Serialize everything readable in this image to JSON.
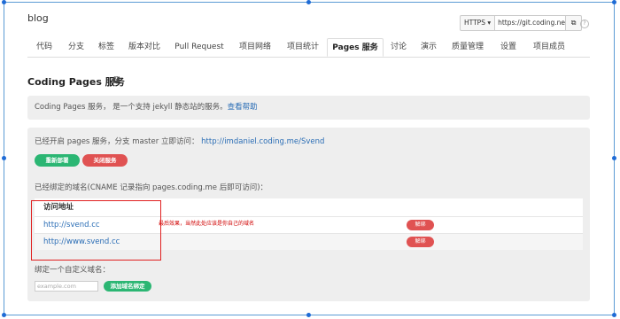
{
  "repo": {
    "name": "blog"
  },
  "clone": {
    "protocol": "HTTPS ▾",
    "url": "https://git.coding.net/",
    "copy_icon": "copy-icon"
  },
  "tabs": [
    {
      "label": "代码"
    },
    {
      "label": "分支"
    },
    {
      "label": "标签"
    },
    {
      "label": "版本对比"
    },
    {
      "label": "Pull Request"
    },
    {
      "label": "项目网络"
    },
    {
      "label": "项目统计"
    },
    {
      "label": "Pages 服务",
      "active": true
    },
    {
      "label": "讨论"
    },
    {
      "label": "演示"
    },
    {
      "label": "质量管理"
    },
    {
      "label": "设置"
    },
    {
      "label": "项目成员"
    }
  ],
  "page": {
    "title": "Coding Pages 服务",
    "info_text": "Coding Pages 服务， 是一个支持 jekyll 静态站的服务。",
    "info_link": "查看帮助"
  },
  "pages_status": {
    "enabled_text": "已经开启 pages 服务，分支 master 立即访问：",
    "enabled_link": "http://imdaniel.coding.me/Svend",
    "redeploy_label": "重新部署",
    "close_label": "关闭服务"
  },
  "bound_domains": {
    "title": "已经绑定的域名(CNAME 记录指向 pages.coding.me 后即可访问)：",
    "header": "访问地址",
    "rows": [
      {
        "url": "http://svend.cc",
        "action": "解绑"
      },
      {
        "url": "http://www.svend.cc",
        "action": "解绑"
      }
    ]
  },
  "annotation": "最后效果，当然此处应该是你自己的域名",
  "custom_domain": {
    "title": "绑定一个自定义域名：",
    "placeholder": "example.com",
    "add_label": "添加域名绑定"
  },
  "colors": {
    "green": "#2bb673",
    "red": "#e05252",
    "link": "#2a6db5",
    "frame": "#5b9bd5",
    "annotation": "#d00000"
  }
}
